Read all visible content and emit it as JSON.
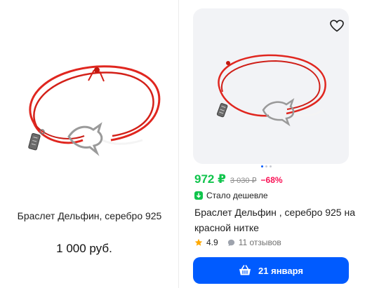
{
  "left_card": {
    "title": "Браслет Дельфин, серебро 925",
    "price": "1 000 руб."
  },
  "right_card": {
    "price_current": "972 ₽",
    "price_old": "3 030 ₽",
    "discount": "−68%",
    "cheaper_label": "Стало дешевле",
    "title": "Браслет Дельфин , серебро 925 на красной нитке",
    "rating": "4.9",
    "reviews": "11 отзывов",
    "cart_button_label": "21 января",
    "carousel_dots": 3,
    "carousel_active_index": 0
  },
  "colors": {
    "accent_blue": "#005bff",
    "price_green": "#10c44c",
    "discount_pink": "#f91155",
    "star_orange": "#ffa900",
    "thread_red": "#e0261f"
  },
  "icons": {
    "favorite": "heart-outline-icon",
    "cheaper": "arrow-down-badge-icon",
    "rating": "star-icon",
    "reviews": "chat-bubble-icon",
    "cart": "basket-icon"
  }
}
